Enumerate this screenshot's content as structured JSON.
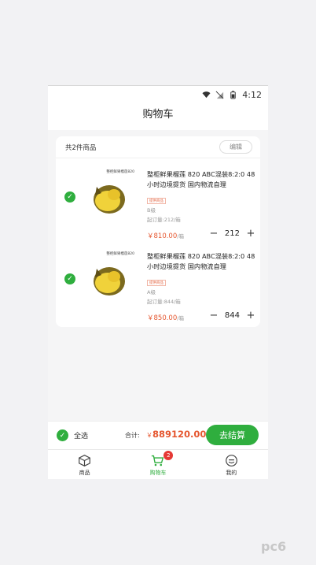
{
  "status_bar": {
    "time": "4:12"
  },
  "header": {
    "title": "购物车"
  },
  "cart": {
    "count_text": "共2件商品",
    "edit_label": "编辑",
    "items": [
      {
        "image_label": "整柜鲜果榴莲820",
        "title": "整柜鲜果榴莲 820 ABC混装8:2:0 48小时边境提货 国内物流自理",
        "tag": "提供商品",
        "grade": "B级",
        "moq": "起订量:212/箱",
        "price": "￥810.00",
        "unit": "/箱",
        "quantity": "212"
      },
      {
        "image_label": "整柜鲜果榴莲820",
        "title": "整柜鲜果榴莲 820 ABC混装8:2:0 48小时边境提货 国内物流自理",
        "tag": "提供商品",
        "grade": "A级",
        "moq": "起订量:844/箱",
        "price": "￥850.00",
        "unit": "/箱",
        "quantity": "844"
      }
    ]
  },
  "footer": {
    "select_all_label": "全选",
    "total_label": "合计:",
    "total_currency": "￥",
    "total_value": "889120.00",
    "checkout_label": "去结算"
  },
  "tabs": [
    {
      "label": "商品",
      "icon": "box-icon"
    },
    {
      "label": "购物车",
      "icon": "cart-icon",
      "badge": "2"
    },
    {
      "label": "我的",
      "icon": "user-icon"
    }
  ],
  "watermark": "pc6",
  "colors": {
    "accent": "#2fae3e",
    "price": "#e5562f",
    "badge": "#e53935"
  }
}
